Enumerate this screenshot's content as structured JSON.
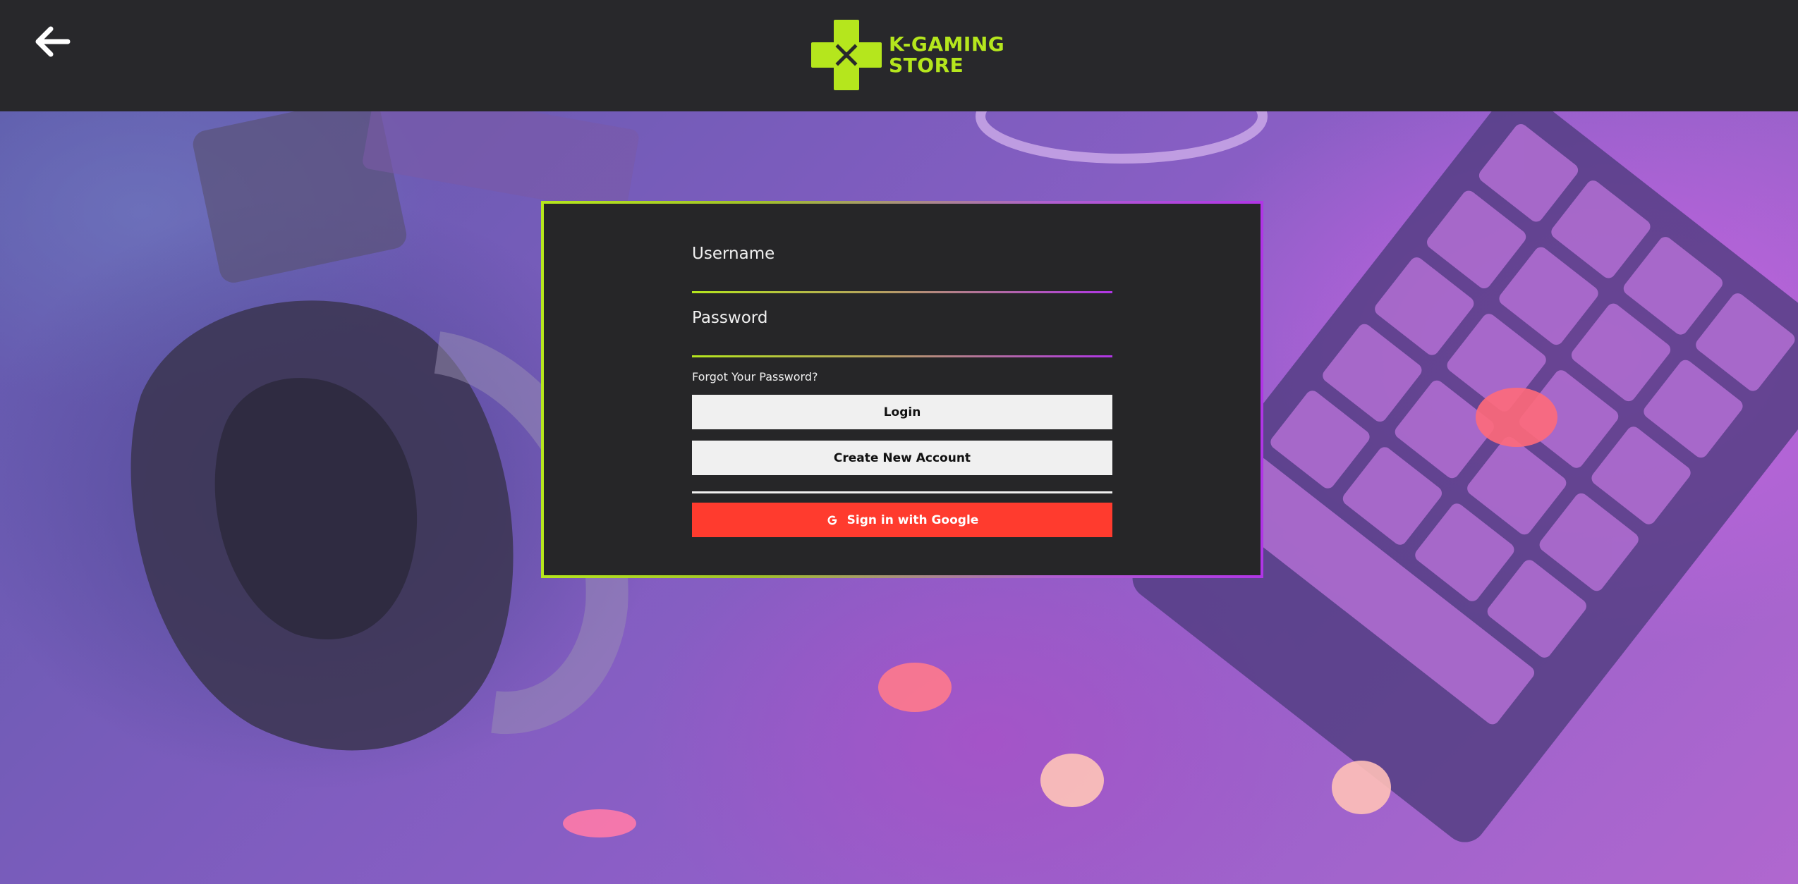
{
  "header": {
    "back_icon": "arrow-left-icon",
    "logo": {
      "icon": "gamepad-cross-icon",
      "line1": "K-GAMING",
      "line2": "STORE",
      "color": "#b5e61d"
    }
  },
  "login_form": {
    "username_label": "Username",
    "username_value": "",
    "password_label": "Password",
    "password_value": "",
    "forgot_link": "Forgot Your Password?",
    "login_button": "Login",
    "create_account_button": "Create New Account",
    "google_button": "Sign in with Google",
    "google_icon": "google-g-icon"
  },
  "colors": {
    "header_bg": "#28282b",
    "card_bg": "#262628",
    "accent_green": "#b5e61d",
    "accent_purple": "#b035e6",
    "google_red": "#ff3b2e",
    "button_light": "#f0f0f0"
  }
}
